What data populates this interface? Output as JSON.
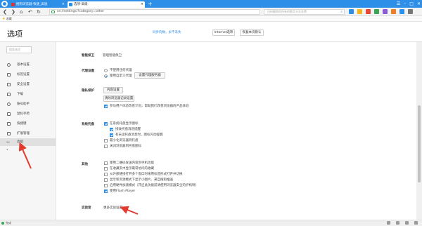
{
  "browser": {
    "tabs": [
      {
        "label": "搜狗浏览器-快速_高速"
      },
      {
        "label": "选项-高级"
      }
    ],
    "new_tab_symbol": "+",
    "address": "se://settings/?category=other",
    "search_placeholder": "扫码删除的所有的数字卡车车费",
    "bookmark_label": "收藏",
    "window_controls": [
      "☰",
      "–",
      "□",
      "✕"
    ]
  },
  "header": {
    "title": "选项",
    "sync_link": "同步的数，永不丢失",
    "internet_options_button": "Internet选项",
    "restore_defaults_button": "恢复本页默认"
  },
  "sidebar": {
    "search_placeholder": "搜索选项",
    "items": [
      {
        "label": "基本设置",
        "icon": "circle-icon"
      },
      {
        "label": "标签设置",
        "icon": "tab-icon"
      },
      {
        "label": "安全设置",
        "icon": "shield-icon"
      },
      {
        "label": "下载",
        "icon": "download-icon"
      },
      {
        "label": "账号助手",
        "icon": "user-icon"
      },
      {
        "label": "鼠标手势",
        "icon": "mouse-icon"
      },
      {
        "label": "快捷键",
        "icon": "keyboard-icon"
      },
      {
        "label": "扩展管理",
        "icon": "puzzle-icon"
      },
      {
        "label": "高级",
        "icon": "more-icon",
        "active": true
      }
    ]
  },
  "main": {
    "smart_guard": {
      "label": "智能保卫",
      "text": "管理智能保卫"
    },
    "proxy": {
      "label": "代理设置",
      "option_none": "不使用任何代理",
      "option_custom": "使用自定义代理",
      "proxy_button": "设置代理服务器"
    },
    "privacy": {
      "label": "隐私保护",
      "content_button": "内容设置",
      "clear_button": "清除浏览器记录设置",
      "experience_text": "参与用户体验改善计划，帮助我们改善浏览器的产品体验"
    },
    "system_tray": {
      "label": "系统托盘",
      "show_tray_icon": "在系统托盘显示图标",
      "receive_msg": "接收托盘消息提醒",
      "new_version": "有未读托盘消息时，图标闪动提醒",
      "minimize_to_tray": "最小化浏览器到托盘",
      "close_to_tray": "关闭浏览器到托盘图标"
    },
    "other": {
      "label": "其他",
      "opt1": "使用二维码发送内容到手机功能",
      "opt2": "在收藏夹中显示最常访问的收藏",
      "opt3": "从外部链接打开多个窗口时采用标签形式打开并切换",
      "opt4": "显示新资源模式下显示小图片、来自搜狗推送",
      "opt5": "启用硬件加速模式（开启此功能前请使用浏览器安全的护机制）",
      "opt6": "使用Flash Player"
    },
    "lab": {
      "label": "实验室",
      "link": "更多实验设置"
    }
  },
  "status": {
    "text": "完成"
  },
  "colors": {
    "accent": "#2e8fe8",
    "annotation": "#e23b2e"
  }
}
